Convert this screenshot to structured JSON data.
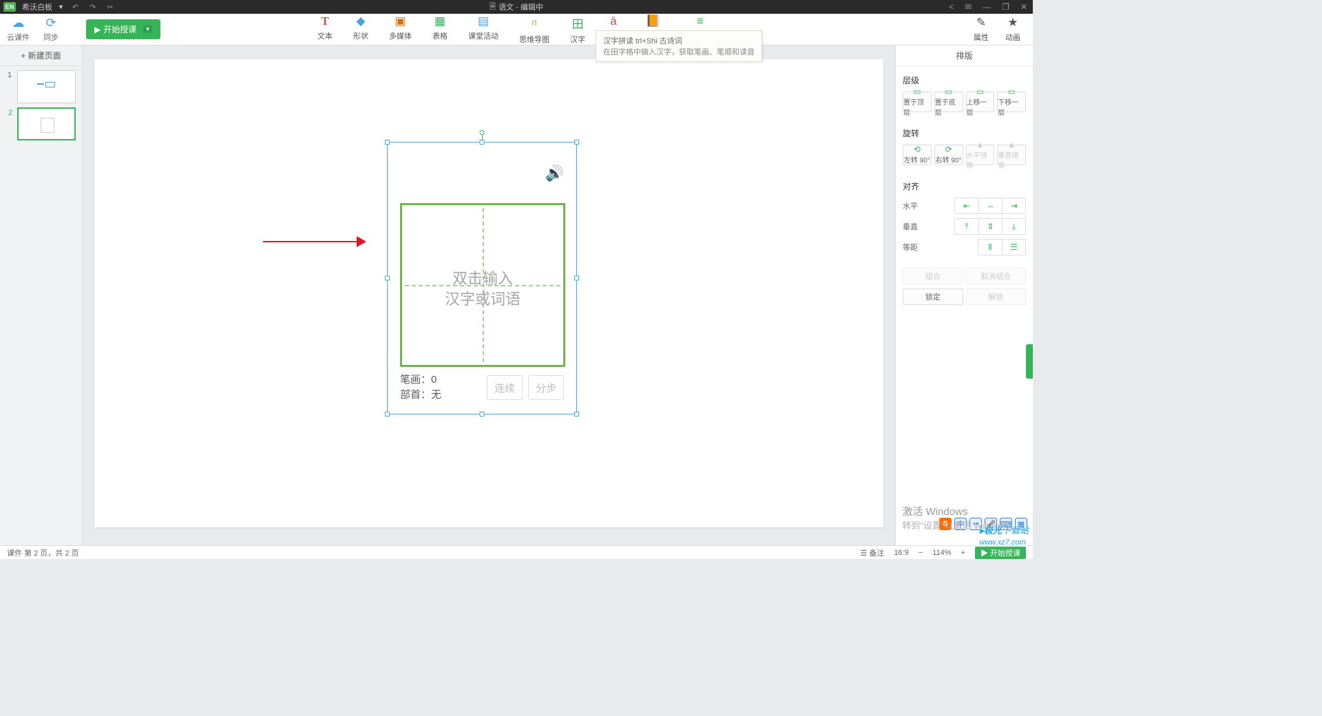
{
  "titlebar": {
    "logo": "EN",
    "app_name": "希沃白板",
    "doc_icon": "🗎",
    "doc_title": "语文 - 编辑中"
  },
  "ribbon": {
    "cloud": "云课件",
    "sync": "同步",
    "start": "开始授课",
    "tools": {
      "text": "文本",
      "shape": "形状",
      "media": "多媒体",
      "table": "表格",
      "activity": "课堂活动",
      "mindmap": "思维导图",
      "hanzi": "汉字",
      "pinyin": "拼音",
      "poem": "古诗词",
      "subject": "学科工具"
    },
    "right": {
      "props": "属性",
      "anim": "动画"
    }
  },
  "tooltip": {
    "line1": "汉字拼读 trl+Shi 古诗词",
    "line2": "在田字格中输入汉字，获取笔画、笔顺和读音"
  },
  "leftpanel": {
    "new_page": "+ 新建页面"
  },
  "card": {
    "placeholder_l1": "双击输入",
    "placeholder_l2": "汉字或词语",
    "strokes_label": "笔画：",
    "strokes_val": "0",
    "radical_label": "部首：",
    "radical_val": "无",
    "btn_cont": "连续",
    "btn_step": "分步"
  },
  "rightpanel": {
    "tab": "排版",
    "sec_layer": "层级",
    "top": "置于顶层",
    "bottom": "置于底层",
    "up": "上移一层",
    "down": "下移一层",
    "sec_rotate": "旋转",
    "rot_l": "左转 90°",
    "rot_r": "右转 90°",
    "flip_h": "水平镜像",
    "flip_v": "垂直镜像",
    "sec_align": "对齐",
    "al_h": "水平",
    "al_v": "垂直",
    "al_d": "等距",
    "group": "组合",
    "ungroup": "取消组合",
    "lock": "锁定",
    "unlock": "解锁"
  },
  "status": {
    "left": "课件 第 2 页，共 2 页",
    "note": "备注",
    "ratio": "16:9",
    "zoom": "114%",
    "play": "▶ 开始授课"
  },
  "watermark": {
    "win1": "激活 Windows",
    "win2": "转到\"设置\"以激活 Windows。",
    "site_prefix": "▸极光",
    "site_text": "下载站",
    "site_url": "www.xz7.com"
  }
}
